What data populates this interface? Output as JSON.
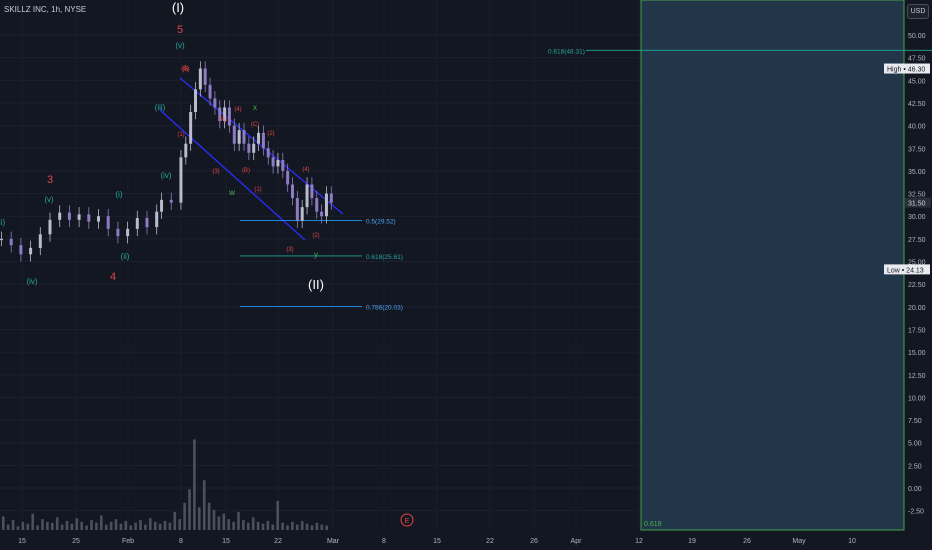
{
  "header": {
    "symbol_title": "SKILLZ INC, 1h, NYSE",
    "currency_button": "USD"
  },
  "chart_data": {
    "type": "candlestick",
    "title": "SKILLZ INC, 1h, NYSE",
    "y_axis": {
      "ticks": [
        "50.00",
        "47.50",
        "45.00",
        "42.50",
        "40.00",
        "37.50",
        "35.00",
        "32.50",
        "30.00",
        "27.50",
        "25.00",
        "22.50",
        "20.00",
        "17.50",
        "15.00",
        "12.50",
        "10.00",
        "7.50",
        "5.00",
        "2.50",
        "0.00",
        "-2.50"
      ],
      "range": [
        -2.5,
        50
      ],
      "last_price": "31.50",
      "high_label": {
        "text": "High",
        "value": "46.30"
      },
      "low_label": {
        "text": "Low",
        "value": "24.13"
      }
    },
    "x_axis": {
      "ticks": [
        "15",
        "25",
        "Feb",
        "8",
        "15",
        "22",
        "Mar",
        "8",
        "15",
        "22",
        "26",
        "Apr",
        "12",
        "19",
        "26",
        "May",
        "10"
      ]
    },
    "price_path": [
      [
        0,
        27.5
      ],
      [
        2,
        26.8
      ],
      [
        4,
        25.8
      ],
      [
        6,
        26.5
      ],
      [
        8,
        28.0
      ],
      [
        10,
        29.6
      ],
      [
        12,
        30.4
      ],
      [
        14,
        29.6
      ],
      [
        16,
        30.2
      ],
      [
        18,
        29.4
      ],
      [
        20,
        30.0
      ],
      [
        22,
        28.6
      ],
      [
        24,
        27.8
      ],
      [
        26,
        28.6
      ],
      [
        28,
        29.8
      ],
      [
        30,
        28.8
      ],
      [
        32,
        30.5
      ],
      [
        33,
        31.8
      ],
      [
        35,
        31.5
      ],
      [
        37,
        36.5
      ],
      [
        38,
        38.0
      ],
      [
        39,
        41.5
      ],
      [
        40,
        44.0
      ],
      [
        41,
        46.3
      ],
      [
        42,
        44.5
      ],
      [
        43,
        43.0
      ],
      [
        44,
        42.0
      ],
      [
        45,
        40.5
      ],
      [
        46,
        42.0
      ],
      [
        47,
        40.0
      ],
      [
        48,
        38.0
      ],
      [
        49,
        39.5
      ],
      [
        50,
        38.0
      ],
      [
        51,
        37.0
      ],
      [
        52,
        38.0
      ],
      [
        53,
        39.2
      ],
      [
        54,
        37.5
      ],
      [
        55,
        36.5
      ],
      [
        56,
        35.5
      ],
      [
        57,
        36.2
      ],
      [
        58,
        35.0
      ],
      [
        59,
        33.5
      ],
      [
        60,
        32.0
      ],
      [
        61,
        29.5
      ],
      [
        62,
        31.0
      ],
      [
        63,
        33.5
      ],
      [
        64,
        32.0
      ],
      [
        65,
        30.5
      ],
      [
        66,
        30.0
      ],
      [
        67,
        32.5
      ],
      [
        68,
        31.5
      ]
    ],
    "volume": [
      1.5,
      0.6,
      1.1,
      0.4,
      0.9,
      0.7,
      1.8,
      0.5,
      1.2,
      0.9,
      0.8,
      1.4,
      0.6,
      1.0,
      0.7,
      1.3,
      0.9,
      0.5,
      1.1,
      0.8,
      1.6,
      0.6,
      0.9,
      1.2,
      0.7,
      1.0,
      0.5,
      0.8,
      1.1,
      0.6,
      1.3,
      0.9,
      0.7,
      1.0,
      0.8,
      2.0,
      1.2,
      3.0,
      4.5,
      10.0,
      2.5,
      5.5,
      3.0,
      2.2,
      1.5,
      1.8,
      1.2,
      0.9,
      2.0,
      1.1,
      0.8,
      1.4,
      0.9,
      0.7,
      1.0,
      0.6,
      3.2,
      0.8,
      0.5,
      0.9,
      0.6,
      1.0,
      0.7,
      0.5,
      0.8,
      0.6,
      0.5
    ],
    "fib_levels": [
      {
        "label": "0.618(48.31)",
        "value": 48.31
      },
      {
        "label": "0.5(29.52)",
        "value": 29.52
      },
      {
        "label": "0.618(25.61)",
        "value": 25.61
      },
      {
        "label": "0.786(20.03)",
        "value": 20.03
      },
      {
        "label": "0.618"
      }
    ],
    "wave_labels": [
      {
        "text": "(I)",
        "color": "#ffffff",
        "size": 13
      },
      {
        "text": "5",
        "color": "#e04545",
        "size": 11
      },
      {
        "text": "(v)",
        "color": "#26a69a",
        "size": 8
      },
      {
        "text": "(iii)",
        "color": "#26a69a",
        "size": 8
      },
      {
        "text": "(iv)",
        "color": "#26a69a",
        "size": 8
      },
      {
        "text": "3",
        "color": "#e04545",
        "size": 11
      },
      {
        "text": "(v)",
        "color": "#26a69a",
        "size": 8
      },
      {
        "text": "(i)",
        "color": "#26a69a",
        "size": 8
      },
      {
        "text": "ii)",
        "color": "#26a69a",
        "size": 8
      },
      {
        "text": "(ii)",
        "color": "#26a69a",
        "size": 8
      },
      {
        "text": "(iv)",
        "color": "#26a69a",
        "size": 8
      },
      {
        "text": "4",
        "color": "#e04545",
        "size": 11
      },
      {
        "text": "(II)",
        "color": "#ffffff",
        "size": 13
      },
      {
        "text": "x",
        "color": "#4caf50",
        "size": 8
      },
      {
        "text": "w",
        "color": "#4caf50",
        "size": 8
      },
      {
        "text": "y",
        "color": "#4caf50",
        "size": 8
      },
      {
        "text": "(5)",
        "color": "#e04545",
        "size": 6
      },
      {
        "text": "(1)",
        "color": "#e04545",
        "size": 6
      },
      {
        "text": "(4)",
        "color": "#e04545",
        "size": 6
      },
      {
        "text": "(3)",
        "color": "#e04545",
        "size": 6
      },
      {
        "text": "(A)",
        "color": "#e04545",
        "size": 6
      },
      {
        "text": "(C)",
        "color": "#e04545",
        "size": 6
      },
      {
        "text": "(B)",
        "color": "#e04545",
        "size": 6
      },
      {
        "text": "(2)",
        "color": "#e04545",
        "size": 6
      },
      {
        "text": "(1)",
        "color": "#e04545",
        "size": 6
      },
      {
        "text": "(4)",
        "color": "#e04545",
        "size": 6
      },
      {
        "text": "(3)",
        "color": "#e04545",
        "size": 6
      },
      {
        "text": "(2)",
        "color": "#e04545",
        "size": 6
      },
      {
        "text": "(5)",
        "color": "#e04545",
        "size": 6
      }
    ],
    "events": [
      {
        "label": "E",
        "color": "#e04545"
      }
    ],
    "colors": {
      "background": "#131722",
      "up": "#b9bccb",
      "down": "#8e7cc3",
      "fib": "#2196f3",
      "channel": "#2b2cf0",
      "target_zone": "#233a4e",
      "target_border": "#4caf50"
    }
  }
}
